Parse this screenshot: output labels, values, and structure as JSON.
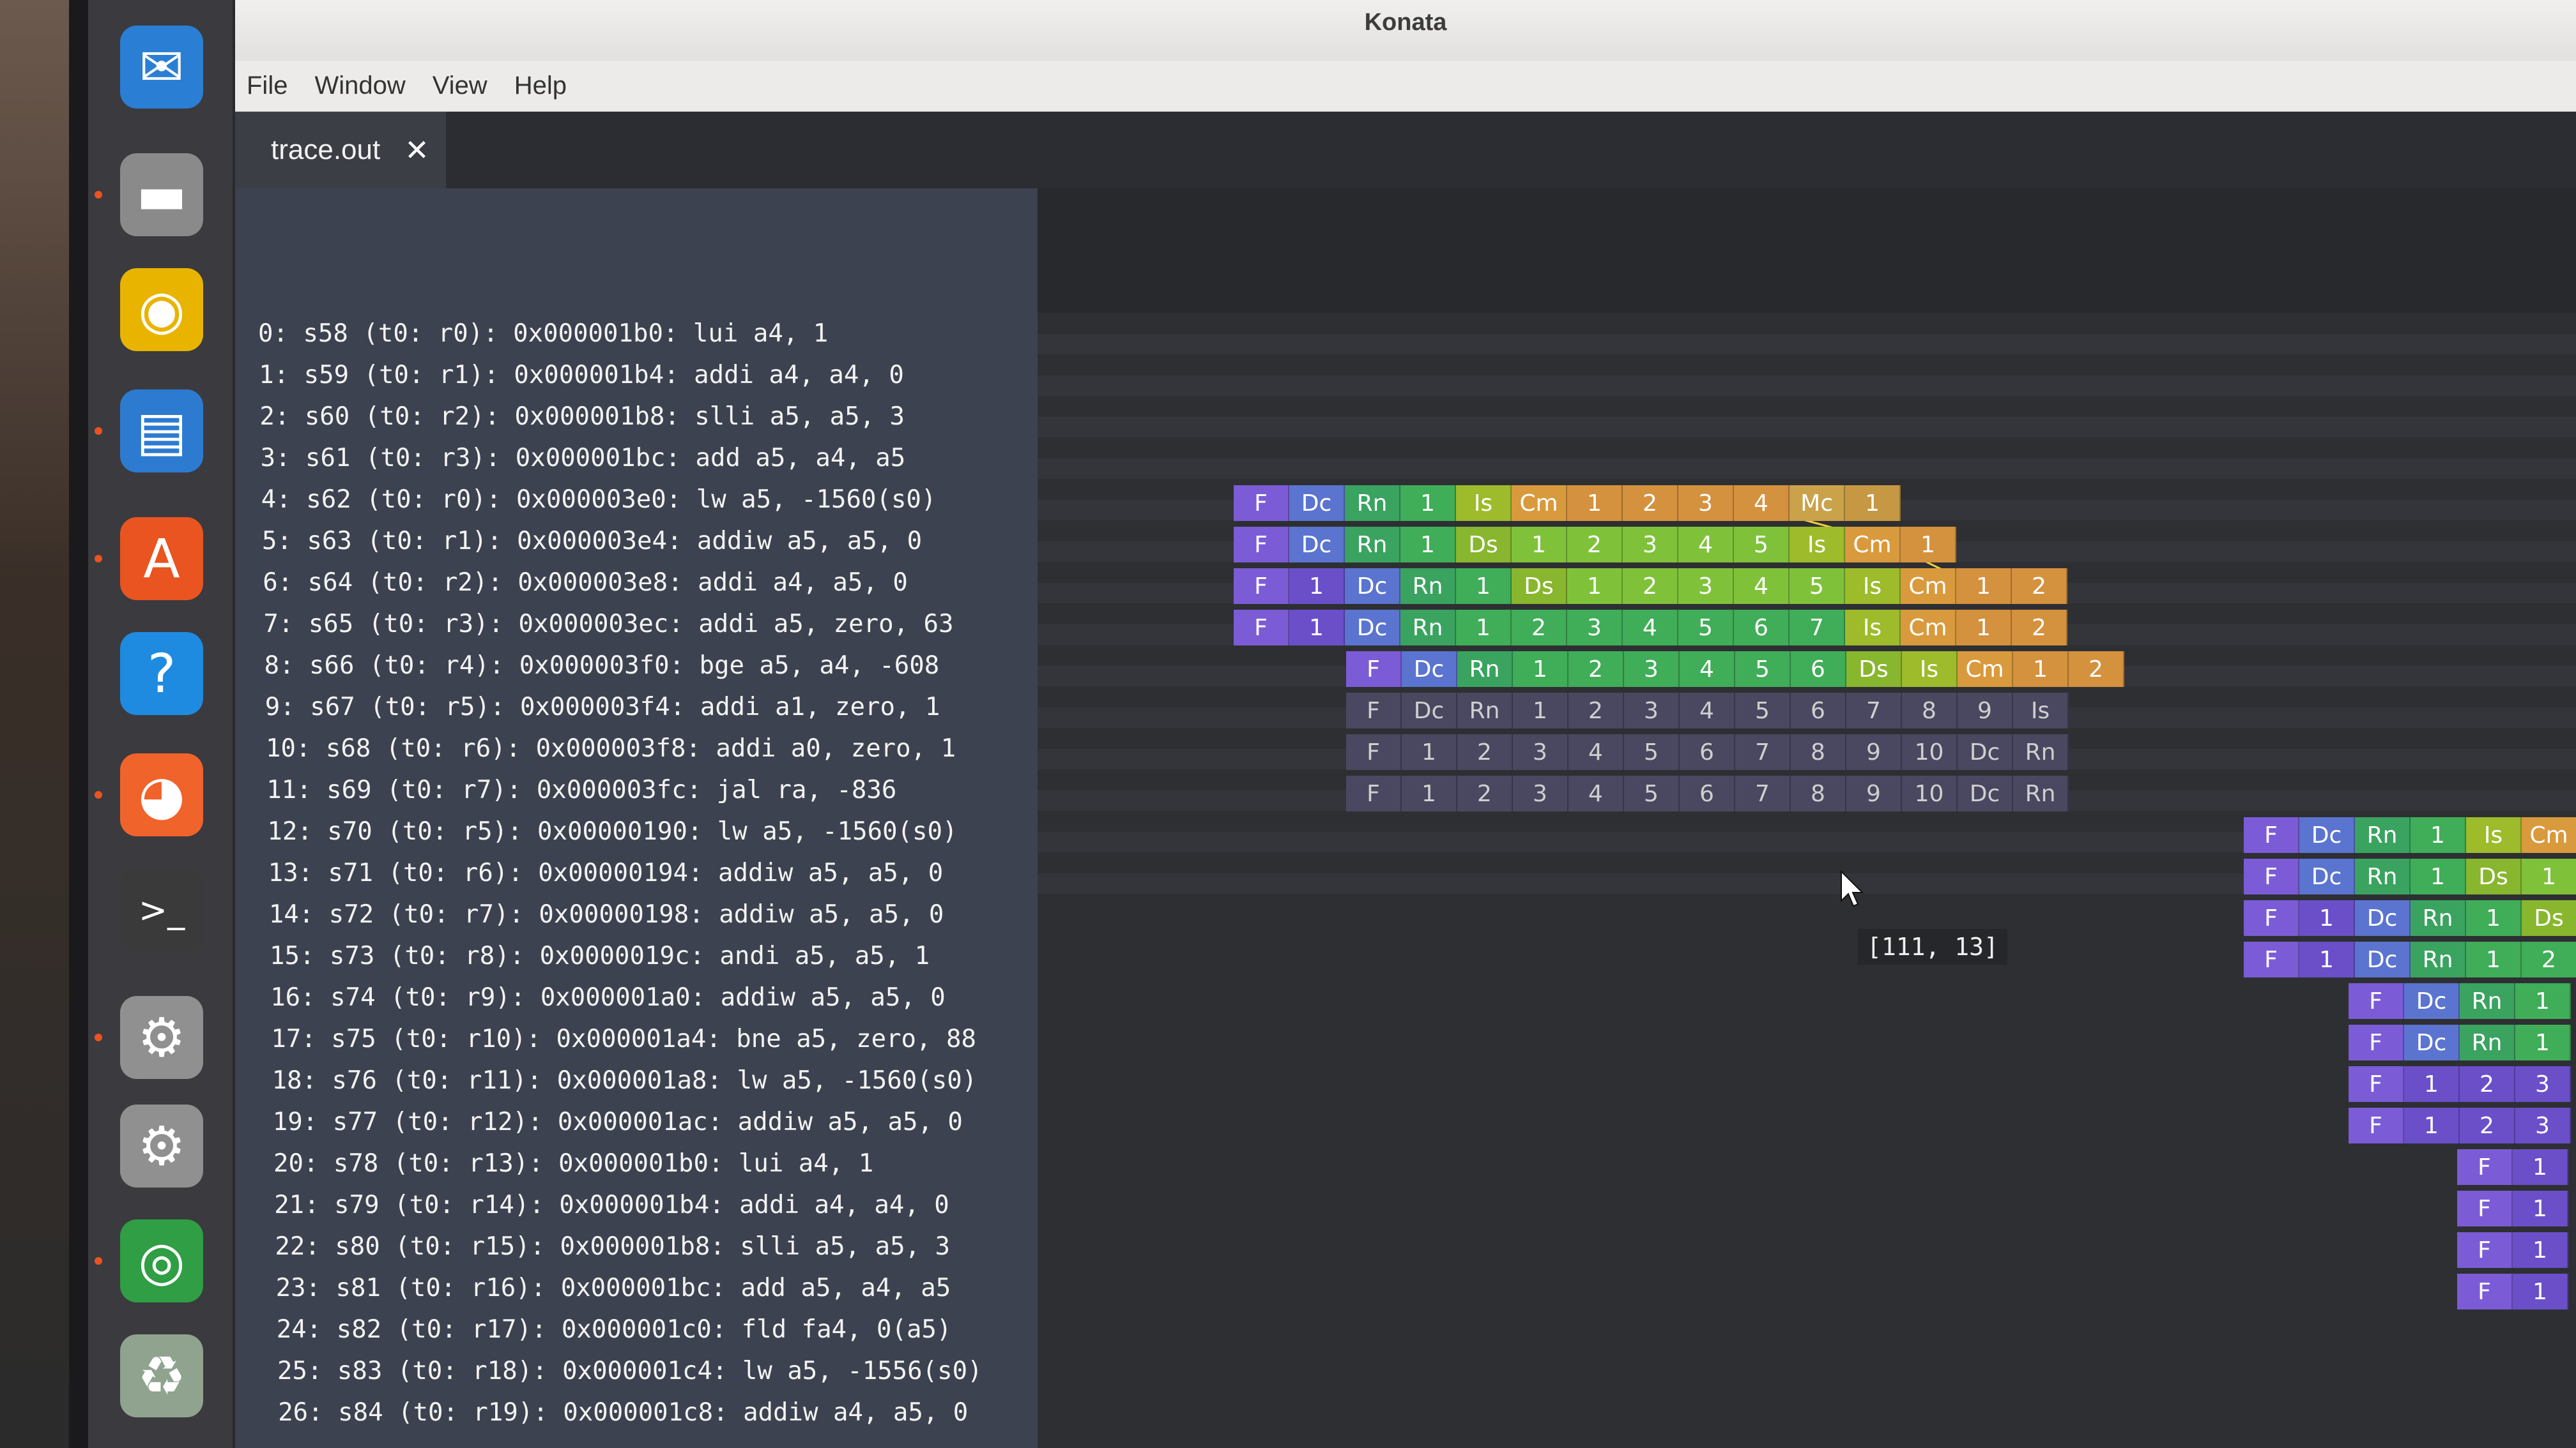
{
  "window": {
    "title": "Konata",
    "menu": [
      "File",
      "Window",
      "View",
      "Help"
    ],
    "tab": {
      "label": "trace.out",
      "close_icon": "close-icon"
    }
  },
  "launcher": [
    {
      "name": "thunderbird-icon",
      "glyph": "✉",
      "color": "#2a7fd4",
      "active": false
    },
    {
      "name": "files-icon",
      "glyph": "▬",
      "color": "#8a8a8a",
      "active": true
    },
    {
      "name": "rhythmbox-icon",
      "glyph": "◉",
      "color": "#e8b400",
      "active": false
    },
    {
      "name": "writer-icon",
      "glyph": "▤",
      "color": "#2c7bd1",
      "active": true
    },
    {
      "name": "software-icon",
      "glyph": "A",
      "color": "#e95420",
      "active": true
    },
    {
      "name": "help-icon",
      "glyph": "?",
      "color": "#1e8be0",
      "active": false
    },
    {
      "name": "firefox-icon",
      "glyph": "◕",
      "color": "#f0632b",
      "active": true
    },
    {
      "name": "terminal-icon",
      "glyph": ">_",
      "color": "#3a3a3a",
      "active": false
    },
    {
      "name": "settings-icon",
      "glyph": "⚙",
      "color": "#909090",
      "active": true
    },
    {
      "name": "settings-icon-2",
      "glyph": "⚙",
      "color": "#909090",
      "active": false
    },
    {
      "name": "chrome-icon",
      "glyph": "◎",
      "color": "#2f9e44",
      "active": true
    },
    {
      "name": "trash-icon",
      "glyph": "♻",
      "color": "#8fa38f",
      "active": false
    }
  ],
  "instructions": [
    "0: s58 (t0: r0): 0x000001b0: lui a4, 1",
    "1: s59 (t0: r1): 0x000001b4: addi a4, a4, 0",
    "2: s60 (t0: r2): 0x000001b8: slli a5, a5, 3",
    "3: s61 (t0: r3): 0x000001bc: add a5, a4, a5",
    "4: s62 (t0: r0): 0x000003e0: lw a5, -1560(s0)",
    "5: s63 (t0: r1): 0x000003e4: addiw a5, a5, 0",
    "6: s64 (t0: r2): 0x000003e8: addi a4, a5, 0",
    "7: s65 (t0: r3): 0x000003ec: addi a5, zero, 63",
    "8: s66 (t0: r4): 0x000003f0: bge a5, a4, -608",
    "9: s67 (t0: r5): 0x000003f4: addi a1, zero, 1",
    "10: s68 (t0: r6): 0x000003f8: addi a0, zero, 1",
    "11: s69 (t0: r7): 0x000003fc: jal ra, -836",
    "12: s70 (t0: r5): 0x00000190: lw a5, -1560(s0)",
    "13: s71 (t0: r6): 0x00000194: addiw a5, a5, 0",
    "14: s72 (t0: r7): 0x00000198: addiw a5, a5, 0",
    "15: s73 (t0: r8): 0x0000019c: andi a5, a5, 1",
    "16: s74 (t0: r9): 0x000001a0: addiw a5, a5, 0",
    "17: s75 (t0: r10): 0x000001a4: bne a5, zero, 88",
    "18: s76 (t0: r11): 0x000001a8: lw a5, -1560(s0)",
    "19: s77 (t0: r12): 0x000001ac: addiw a5, a5, 0",
    "20: s78 (t0: r13): 0x000001b0: lui a4, 1",
    "21: s79 (t0: r14): 0x000001b4: addi a4, a4, 0",
    "22: s80 (t0: r15): 0x000001b8: slli a5, a5, 3",
    "23: s81 (t0: r16): 0x000001bc: add a5, a4, a5",
    "24: s82 (t0: r17): 0x000001c0: fld fa4, 0(a5)",
    "25: s83 (t0: r18): 0x000001c4: lw a5, -1556(s0)",
    "26: s84 (t0: r19): 0x000001c8: addiw a4, a5, 0"
  ],
  "stage_colors": {
    "F": "#7b5cd6",
    "Dc": "#5b74cf",
    "Rn": "#3aa360",
    "Is": "#9dbb2a",
    "Ds": "#88b62e",
    "Cm": "#d89a3c",
    "Mc": "#c9a24a",
    "num": "#7fc23a",
    "num_after_cm": "#d4913e",
    "num_after_f": "#6a4fc9",
    "num_after_rn": "#40ad58",
    "num_after_mc": "#c69844",
    "flushed": "#4a4760"
  },
  "pipeline_rows": [
    {
      "start": 0,
      "flushed": false,
      "stages": [
        "F",
        "Dc",
        "Rn",
        "1",
        "Is",
        "Cm",
        "1",
        "2",
        "3",
        "4",
        "Mc",
        "1"
      ]
    },
    {
      "start": 0,
      "flushed": false,
      "stages": [
        "F",
        "Dc",
        "Rn",
        "1",
        "Ds",
        "1",
        "2",
        "3",
        "4",
        "5",
        "Is",
        "Cm",
        "1"
      ]
    },
    {
      "start": 0,
      "flushed": false,
      "stages": [
        "F",
        "1",
        "Dc",
        "Rn",
        "1",
        "Ds",
        "1",
        "2",
        "3",
        "4",
        "5",
        "Is",
        "Cm",
        "1",
        "2"
      ]
    },
    {
      "start": 0,
      "flushed": false,
      "stages": [
        "F",
        "1",
        "Dc",
        "Rn",
        "1",
        "2",
        "3",
        "4",
        "5",
        "6",
        "7",
        "Is",
        "Cm",
        "1",
        "2"
      ]
    },
    {
      "start": 2,
      "flushed": false,
      "stages": [
        "F",
        "Dc",
        "Rn",
        "1",
        "2",
        "3",
        "4",
        "5",
        "6",
        "Ds",
        "Is",
        "Cm",
        "1",
        "2"
      ]
    },
    {
      "start": 2,
      "flushed": true,
      "stages": [
        "F",
        "Dc",
        "Rn",
        "1",
        "2",
        "3",
        "4",
        "5",
        "6",
        "7",
        "8",
        "9",
        "Is"
      ]
    },
    {
      "start": 2,
      "flushed": true,
      "stages": [
        "F",
        "1",
        "2",
        "3",
        "4",
        "5",
        "6",
        "7",
        "8",
        "9",
        "10",
        "Dc",
        "Rn"
      ]
    },
    {
      "start": 2,
      "flushed": true,
      "stages": [
        "F",
        "1",
        "2",
        "3",
        "4",
        "5",
        "6",
        "7",
        "8",
        "9",
        "10",
        "Dc",
        "Rn"
      ]
    },
    {
      "start": 18,
      "flushed": false,
      "stages": [
        "F",
        "Dc",
        "Rn",
        "1",
        "Is",
        "Cm"
      ]
    },
    {
      "start": 18,
      "flushed": false,
      "stages": [
        "F",
        "Dc",
        "Rn",
        "1",
        "Ds",
        "1"
      ]
    },
    {
      "start": 18,
      "flushed": false,
      "stages": [
        "F",
        "1",
        "Dc",
        "Rn",
        "1",
        "Ds"
      ]
    },
    {
      "start": 18,
      "flushed": false,
      "stages": [
        "F",
        "1",
        "Dc",
        "Rn",
        "1",
        "2"
      ]
    },
    {
      "start": 20,
      "flushed": false,
      "stages": [
        "F",
        "Dc",
        "Rn",
        "1"
      ]
    },
    {
      "start": 20,
      "flushed": false,
      "stages": [
        "F",
        "Dc",
        "Rn",
        "1"
      ]
    },
    {
      "start": 20,
      "flushed": false,
      "stages": [
        "F",
        "1",
        "2",
        "3"
      ]
    },
    {
      "start": 20,
      "flushed": false,
      "stages": [
        "F",
        "1",
        "2",
        "3"
      ]
    },
    {
      "start": 22,
      "flushed": false,
      "stages": [
        "F",
        "1"
      ]
    },
    {
      "start": 22,
      "flushed": false,
      "stages": [
        "F",
        "1"
      ]
    },
    {
      "start": 22,
      "flushed": false,
      "stages": [
        "F",
        "1"
      ]
    },
    {
      "start": 22,
      "flushed": false,
      "stages": [
        "F",
        "1"
      ]
    }
  ],
  "tooltip": "[111, 13]"
}
